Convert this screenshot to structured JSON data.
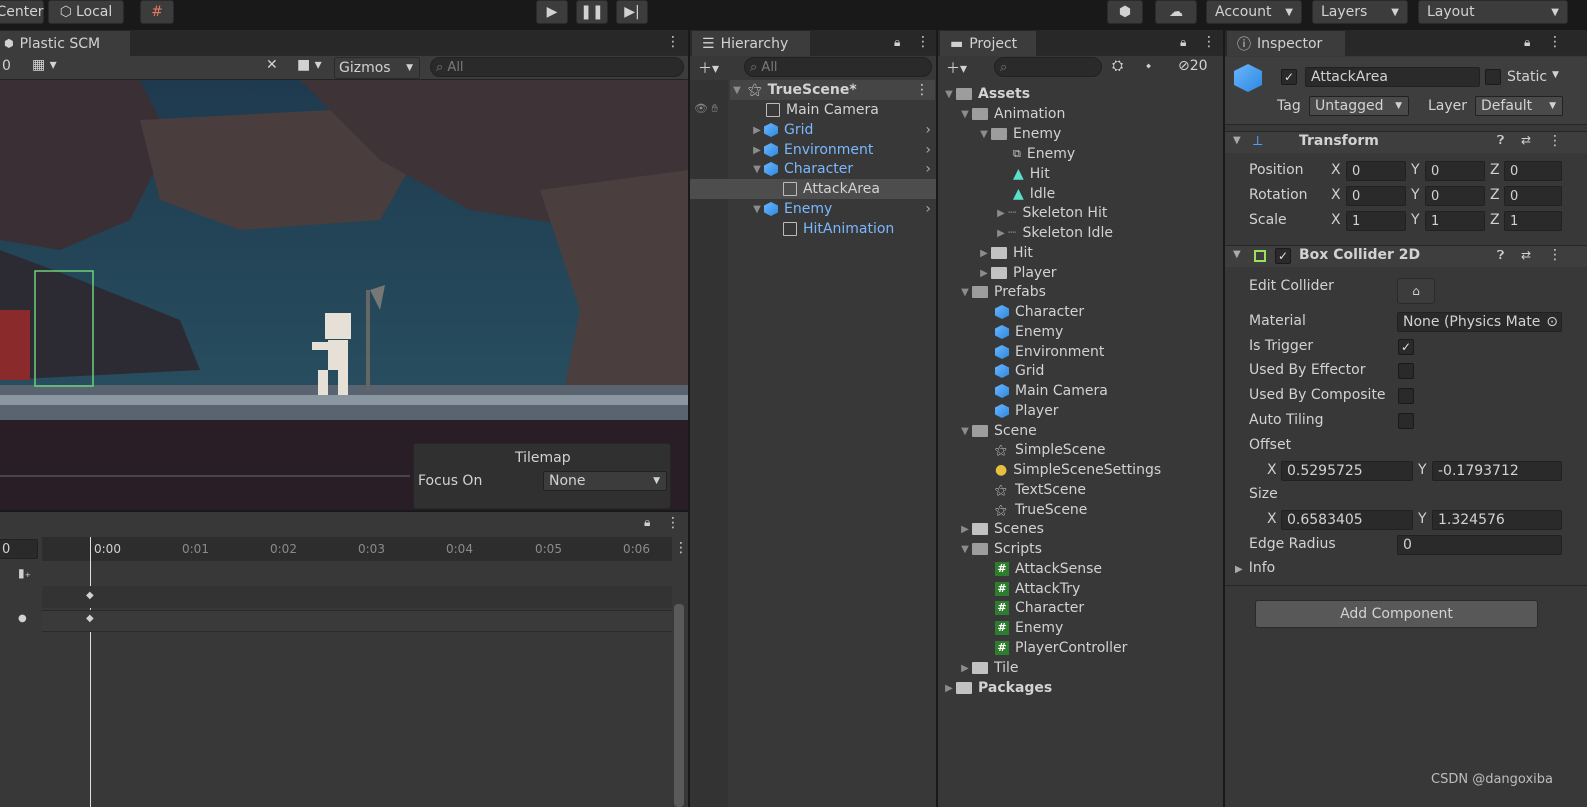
{
  "toolbar": {
    "pivot_center": "Center",
    "pivot_local": "Local",
    "account": "Account",
    "layers": "Layers",
    "layout": "Layout"
  },
  "scene": {
    "tab": "Plastic SCM",
    "counter": "0",
    "gizmos": "Gizmos",
    "search_placeholder": "All",
    "tilemap_title": "Tilemap",
    "focus_label": "Focus On",
    "focus_value": "None"
  },
  "animation": {
    "frame_field": "0",
    "ticks": [
      "0:00",
      "0:01",
      "0:02",
      "0:03",
      "0:04",
      "0:05",
      "0:06"
    ]
  },
  "hierarchy": {
    "tab": "Hierarchy",
    "search_placeholder": "All",
    "scene_name": "TrueScene*",
    "items": [
      {
        "label": "Main Camera"
      },
      {
        "label": "Grid"
      },
      {
        "label": "Environment"
      },
      {
        "label": "Character"
      },
      {
        "label": "AttackArea"
      },
      {
        "label": "Enemy"
      },
      {
        "label": "HitAnimation"
      }
    ]
  },
  "project": {
    "tab": "Project",
    "hidden_count": "20",
    "tree": [
      {
        "label": "Assets"
      },
      {
        "label": "Animation"
      },
      {
        "label": "Enemy"
      },
      {
        "label": "Enemy"
      },
      {
        "label": "Hit"
      },
      {
        "label": "Idle"
      },
      {
        "label": "Skeleton Hit"
      },
      {
        "label": "Skeleton Idle"
      },
      {
        "label": "Hit"
      },
      {
        "label": "Player"
      },
      {
        "label": "Prefabs"
      },
      {
        "label": "Character"
      },
      {
        "label": "Enemy"
      },
      {
        "label": "Environment"
      },
      {
        "label": "Grid"
      },
      {
        "label": "Main Camera"
      },
      {
        "label": "Player"
      },
      {
        "label": "Scene"
      },
      {
        "label": "SimpleScene"
      },
      {
        "label": "SimpleSceneSettings"
      },
      {
        "label": "TextScene"
      },
      {
        "label": "TrueScene"
      },
      {
        "label": "Scenes"
      },
      {
        "label": "Scripts"
      },
      {
        "label": "AttackSense"
      },
      {
        "label": "AttackTry"
      },
      {
        "label": "Character"
      },
      {
        "label": "Enemy"
      },
      {
        "label": "PlayerController"
      },
      {
        "label": "Tile"
      },
      {
        "label": "Packages"
      }
    ]
  },
  "inspector": {
    "tab": "Inspector",
    "object_name": "AttackArea",
    "static_label": "Static",
    "tag_label": "Tag",
    "tag_value": "Untagged",
    "layer_label": "Layer",
    "layer_value": "Default",
    "transform": {
      "title": "Transform",
      "position_label": "Position",
      "rotation_label": "Rotation",
      "scale_label": "Scale",
      "position": {
        "x": "0",
        "y": "0",
        "z": "0"
      },
      "rotation": {
        "x": "0",
        "y": "0",
        "z": "0"
      },
      "scale": {
        "x": "1",
        "y": "1",
        "z": "1"
      }
    },
    "collider": {
      "title": "Box Collider 2D",
      "edit_collider": "Edit Collider",
      "material_label": "Material",
      "material_value": "None (Physics Mate",
      "is_trigger": "Is Trigger",
      "used_by_effector": "Used By Effector",
      "used_by_composite": "Used By Composite",
      "auto_tiling": "Auto Tiling",
      "offset_label": "Offset",
      "offset_x": "0.5295725",
      "offset_y": "-0.1793712",
      "size_label": "Size",
      "size_x": "0.6583405",
      "size_y": "1.324576",
      "edge_radius_label": "Edge Radius",
      "edge_radius": "0",
      "info": "Info"
    },
    "add_component": "Add Component"
  },
  "watermark": "CSDN @dangoxiba",
  "colors": {
    "accent_blue": "#7bb7ff",
    "panel": "#383838",
    "field": "#2a2a2a"
  }
}
